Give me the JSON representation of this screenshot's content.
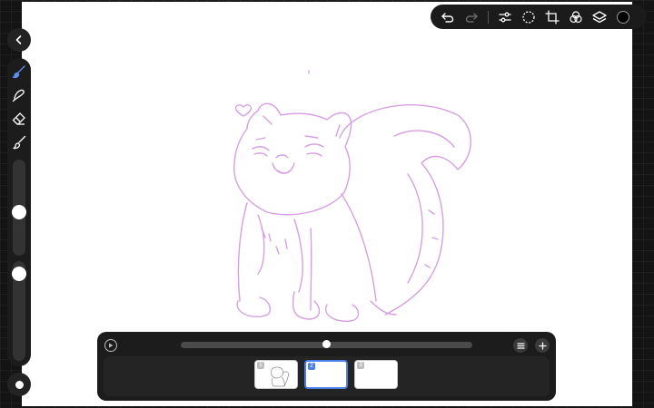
{
  "app": {
    "accent_color": "#4a7fe6",
    "stroke_color": "#d79ee2",
    "canvas_color": "#ffffff"
  },
  "top_toolbar": {
    "items": [
      "undo-icon",
      "redo-icon",
      "adjustments-icon",
      "selection-icon",
      "transform-icon",
      "blend-icon",
      "layers-icon",
      "color-swatch"
    ],
    "current_color": "#000000"
  },
  "left_toolbar": {
    "tools": [
      "brush-icon",
      "smudge-icon",
      "eraser-icon",
      "paint-icon"
    ],
    "active_tool": "brush-icon",
    "size_slider_value": 0.55,
    "opacity_slider_value": 0.0
  },
  "timeline": {
    "playhead_fraction": 0.5,
    "frames": [
      {
        "number": "1",
        "selected": false,
        "has_content": true
      },
      {
        "number": "2",
        "selected": true,
        "has_content": false
      },
      {
        "number": "3",
        "selected": false,
        "has_content": false
      }
    ]
  }
}
